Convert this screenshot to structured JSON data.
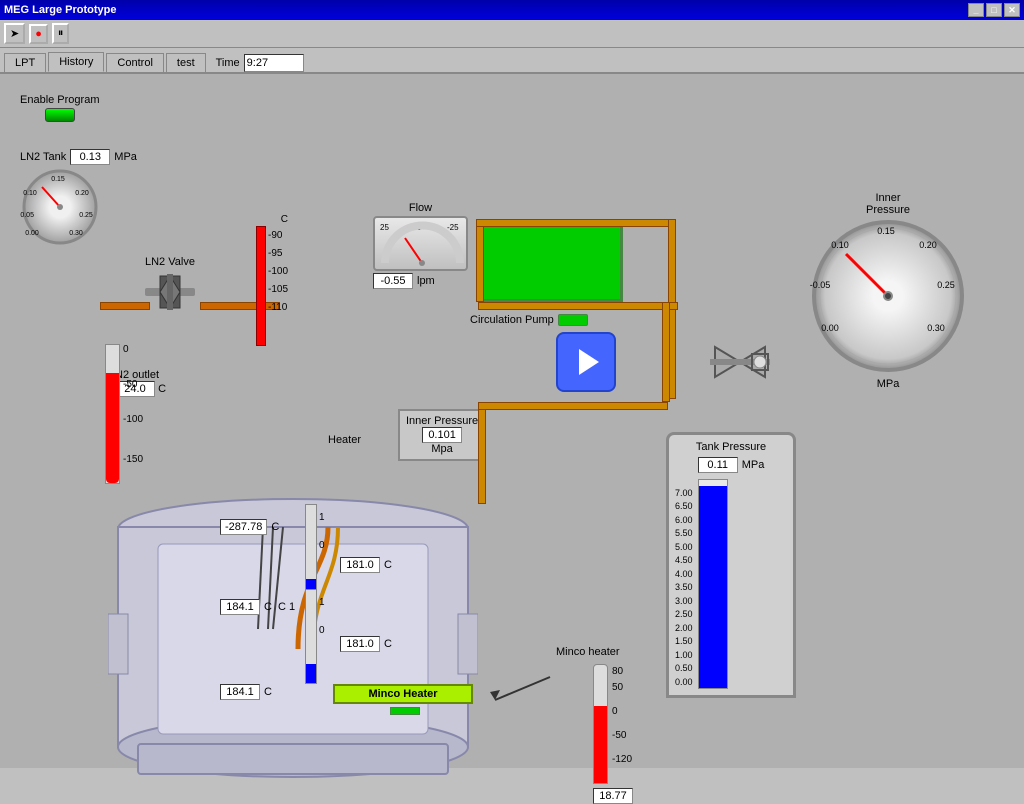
{
  "window": {
    "title": "MEG Large Prototype"
  },
  "toolbar": {
    "record_label": "●",
    "pause_label": "⏸"
  },
  "tabs": {
    "lpt": "LPT",
    "history": "History",
    "control": "Control",
    "test": "test",
    "time_label": "Time",
    "time_value": "9:27"
  },
  "enable_program": {
    "label": "Enable Program"
  },
  "ln2_tank": {
    "label": "LN2 Tank",
    "value": "0.13",
    "unit": "MPa"
  },
  "ln2_valve": {
    "label": "LN2 Valve"
  },
  "n2_outlet": {
    "label": "N2 outlet",
    "value": "24.0",
    "unit": "C"
  },
  "flow": {
    "label": "Flow",
    "value": "-0.55",
    "unit": "lpm",
    "scale_left": "25",
    "scale_zero": "0",
    "scale_right": "-25"
  },
  "inner_pressure_box": {
    "label": "Inner Pressure",
    "value": "0.101",
    "unit": "Mpa"
  },
  "inner_pressure_gauge": {
    "label1": "Inner",
    "label2": "Pressure",
    "value": "0.10",
    "unit": "MPa",
    "scale": [
      "0.15",
      "0.20",
      "0.25",
      "0.30",
      "0.00",
      "-0.05",
      "0.10"
    ]
  },
  "circulation_pump": {
    "label": "Circulation Pump"
  },
  "tank_temp1": {
    "value": "-287.78",
    "unit": "C"
  },
  "tank_temp1_set": {
    "value": "181.0",
    "unit": "C"
  },
  "tank_temp2": {
    "value": "184.1",
    "unit": "C"
  },
  "tank_temp2_set": {
    "value": "181.0",
    "unit": "C"
  },
  "tank_temp3": {
    "value": "184.1",
    "unit": "C"
  },
  "heater": {
    "label": "Heater"
  },
  "minco_heater": {
    "label": "Minco heater",
    "bar_label": "Minco Heater",
    "value": "18.77",
    "temp_min": "-120",
    "temp_zero": "0",
    "temp_50": "50",
    "temp_80": "80"
  },
  "tank_pressure": {
    "label": "Tank Pressure",
    "value": "0.11",
    "unit": "MPa",
    "scale": [
      "7.00",
      "6.50",
      "6.00",
      "5.50",
      "5.00",
      "4.50",
      "4.00",
      "3.50",
      "3.00",
      "2.50",
      "2.00",
      "1.50",
      "1.00",
      "0.50",
      "0.00"
    ]
  },
  "temp_bar_values": {
    "zero": "0",
    "neg50": "-50",
    "neg100": "-100",
    "neg150": "-150"
  },
  "heater_label": "Heater",
  "column_labels": {
    "c": "C"
  }
}
